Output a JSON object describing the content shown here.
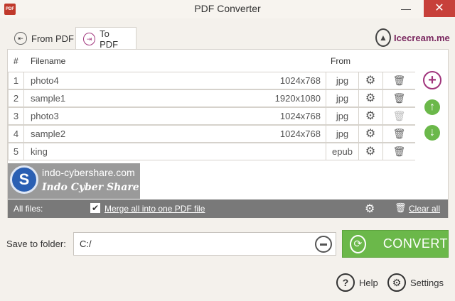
{
  "window": {
    "title": "PDF Converter",
    "app_icon_text": "PDF",
    "minimize": "—",
    "close": "✕"
  },
  "tabs": [
    {
      "label": "From PDF",
      "active": false
    },
    {
      "label": "To PDF",
      "active": true
    }
  ],
  "brand": {
    "name": "Icecream.me"
  },
  "table": {
    "headers": {
      "num": "#",
      "filename": "Filename",
      "from": "From"
    },
    "rows": [
      {
        "num": "1",
        "name": "photo4",
        "resolution": "1024x768",
        "ext": "jpg",
        "delete_enabled": true
      },
      {
        "num": "2",
        "name": "sample1",
        "resolution": "1920x1080",
        "ext": "jpg",
        "delete_enabled": true
      },
      {
        "num": "3",
        "name": "photo3",
        "resolution": "1024x768",
        "ext": "jpg",
        "delete_enabled": false
      },
      {
        "num": "4",
        "name": "sample2",
        "resolution": "1024x768",
        "ext": "jpg",
        "delete_enabled": true
      },
      {
        "num": "5",
        "name": "king",
        "resolution": "",
        "ext": "epub",
        "delete_enabled": true
      }
    ]
  },
  "side_buttons": {
    "add": "+",
    "up": "↑",
    "down": "↓"
  },
  "watermark": {
    "logo_letter": "S",
    "line1": "indo-cybershare.com",
    "line2": "Indo Cyber Share"
  },
  "footer": {
    "all_files_label": "All files:",
    "merge_checked": true,
    "merge_label": "Merge all into one PDF file",
    "clear_label": "Clear all"
  },
  "save": {
    "label": "Save to folder:",
    "path": "C:/"
  },
  "convert": {
    "label": "CONVERT"
  },
  "links": {
    "help": "Help",
    "settings": "Settings"
  },
  "colors": {
    "accent_green": "#6bb84a",
    "accent_purple": "#a0357c",
    "footer_bg": "#797979",
    "close_red": "#c7403a"
  },
  "icons": {
    "gear": "gear-icon",
    "trash": "trash-icon",
    "folder": "folder-icon",
    "refresh": "refresh-icon",
    "help": "question-icon"
  }
}
